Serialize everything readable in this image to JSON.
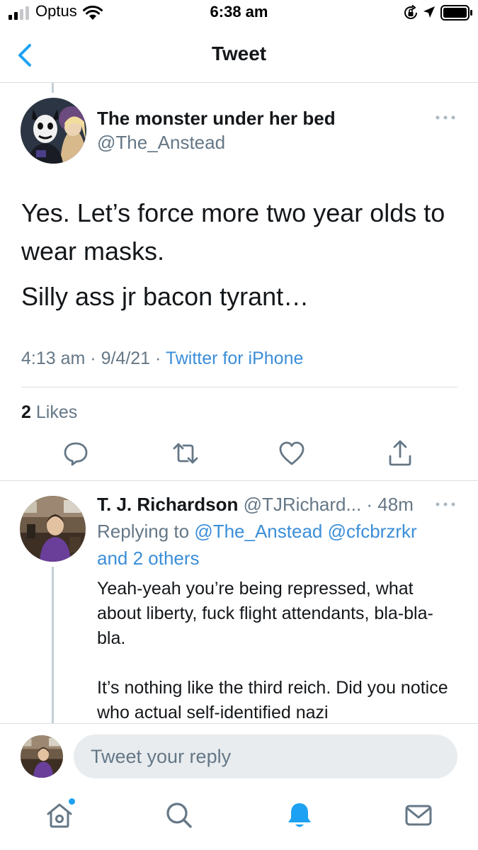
{
  "status_bar": {
    "carrier": "Optus",
    "time": "6:38 am"
  },
  "header": {
    "title": "Tweet"
  },
  "tweet": {
    "display_name": "The monster under her bed",
    "handle": "@The_Anstead",
    "lines": [
      "Yes. Let’s force more two year olds to wear masks.",
      "Silly ass jr bacon tyrant…"
    ],
    "time": "4:13 am",
    "date": "9/4/21",
    "source": "Twitter for iPhone",
    "likes_count": "2",
    "likes_label": "Likes"
  },
  "reply": {
    "display_name": "T. J. Richardson",
    "handle": "@TJRichard...",
    "age": "48m",
    "replying_to_label": "Replying to",
    "replying_to": "@The_Anstead @cfcbrzrkr and 2 others",
    "paragraphs": [
      "Yeah-yeah you’re being repressed, what about liberty, fuck flight attendants, bla-bla-bla.",
      "It’s nothing like the third reich. Did you notice who actual self-identified nazi"
    ]
  },
  "composer": {
    "placeholder": "Tweet your reply"
  },
  "tabs": {
    "home_icon": "home-icon",
    "search_icon": "search-icon",
    "notifications_icon": "bell-icon",
    "messages_icon": "envelope-icon"
  },
  "colors": {
    "accent": "#1da1f2",
    "link": "#3b8ed8",
    "secondary_text": "#657786",
    "divider": "#d9dfe3"
  }
}
